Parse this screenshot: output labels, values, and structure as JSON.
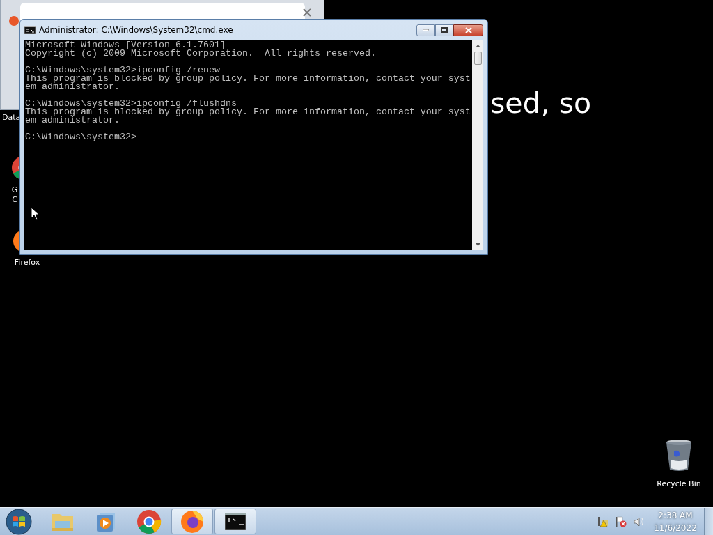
{
  "desktop": {
    "icons": [
      {
        "kind": "partial",
        "label_lines": [
          "Data"
        ]
      },
      {
        "kind": "chrome",
        "label_lines": [
          "G",
          "C"
        ]
      },
      {
        "kind": "firefox",
        "label_lines": [
          "Firefox"
        ]
      },
      {
        "kind": "recycle",
        "label_lines": [
          "Recycle Bin"
        ]
      }
    ],
    "overlay_text": "sed, so"
  },
  "cmd_window": {
    "title": "Administrator: C:\\Windows\\System32\\cmd.exe",
    "console_blocks": [
      [
        "Microsoft Windows [Version 6.1.7601]",
        "Copyright (c) 2009 Microsoft Corporation.  All rights reserved."
      ],
      [
        "C:\\Windows\\system32>ipconfig /renew",
        "This program is blocked by group policy. For more information, contact your syst",
        "em administrator."
      ],
      [
        "C:\\Windows\\system32>ipconfig /flushdns",
        "This program is blocked by group policy. For more information, contact your syst",
        "em administrator."
      ],
      [
        "C:\\Windows\\system32>"
      ]
    ]
  },
  "taskbar": {
    "items": [
      {
        "kind": "explorer",
        "active": false
      },
      {
        "kind": "media",
        "active": false
      },
      {
        "kind": "chrome",
        "active": false
      },
      {
        "kind": "firefox",
        "active": true
      },
      {
        "kind": "cmd",
        "active": true
      }
    ],
    "clock": {
      "time": "2:38 AM",
      "date": "11/6/2022"
    }
  }
}
